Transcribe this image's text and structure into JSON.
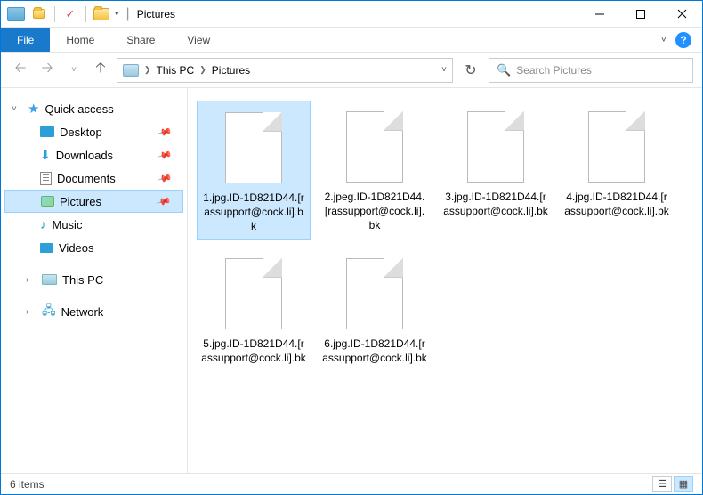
{
  "window": {
    "title": "Pictures"
  },
  "ribbon": {
    "file": "File",
    "tabs": [
      "Home",
      "Share",
      "View"
    ]
  },
  "address": {
    "crumbs": [
      "This PC",
      "Pictures"
    ],
    "search_placeholder": "Search Pictures"
  },
  "sidebar": {
    "quick_access": "Quick access",
    "items": [
      {
        "label": "Desktop",
        "icon": "desktop"
      },
      {
        "label": "Downloads",
        "icon": "downloads"
      },
      {
        "label": "Documents",
        "icon": "documents"
      },
      {
        "label": "Pictures",
        "icon": "pictures",
        "selected": true
      },
      {
        "label": "Music",
        "icon": "music"
      },
      {
        "label": "Videos",
        "icon": "videos"
      }
    ],
    "this_pc": "This PC",
    "network": "Network"
  },
  "files": [
    {
      "name": "1.jpg.ID-1D821D44.[rassupport@cock.li].bk",
      "selected": true
    },
    {
      "name": "2.jpeg.ID-1D821D44.[rassupport@cock.li].bk"
    },
    {
      "name": "3.jpg.ID-1D821D44.[rassupport@cock.li].bk"
    },
    {
      "name": "4.jpg.ID-1D821D44.[rassupport@cock.li].bk"
    },
    {
      "name": "5.jpg.ID-1D821D44.[rassupport@cock.li].bk"
    },
    {
      "name": "6.jpg.ID-1D821D44.[rassupport@cock.li].bk"
    }
  ],
  "status": {
    "text": "6 items"
  }
}
